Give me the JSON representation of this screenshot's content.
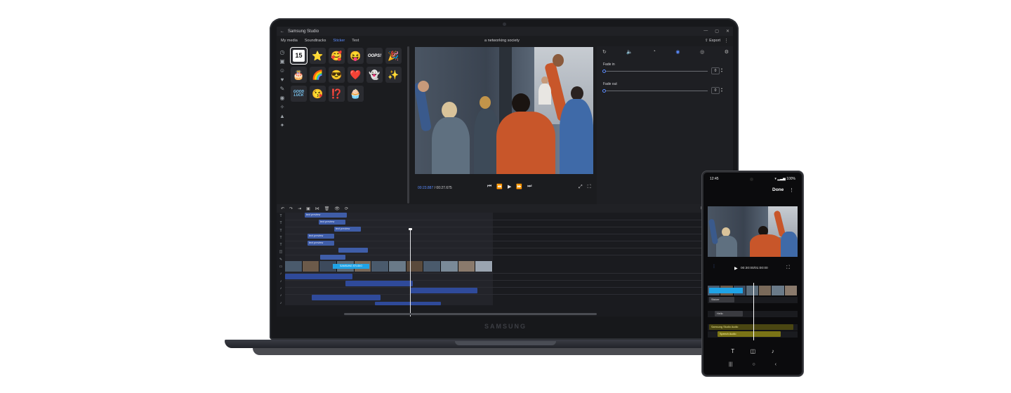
{
  "laptop": {
    "brand": "SAMSUNG",
    "app": {
      "title": "Samsung Studio",
      "back_icon": "arrow-left-icon",
      "tabs": [
        "My media",
        "Soundtracks",
        "Sticker",
        "Text"
      ],
      "active_tab": "Sticker",
      "project_name": "a networking society",
      "export_label": "Export",
      "stickers": [
        {
          "glyph": "15",
          "kind": "badge"
        },
        {
          "glyph": "⭐"
        },
        {
          "glyph": "🥰"
        },
        {
          "glyph": "😝"
        },
        {
          "glyph": "OOPS!",
          "kind": "text"
        },
        {
          "glyph": "🎉"
        },
        {
          "glyph": "🎂"
        },
        {
          "glyph": "🌈"
        },
        {
          "glyph": "😎"
        },
        {
          "glyph": "❤️"
        },
        {
          "glyph": "👻"
        },
        {
          "glyph": "✨"
        },
        {
          "glyph": "GOOD LUCK",
          "kind": "text"
        },
        {
          "glyph": "😘"
        },
        {
          "glyph": "⁉️"
        },
        {
          "glyph": "🧁"
        }
      ],
      "preview": {
        "current_time": "00:23.887",
        "total_time": "00:27.675"
      },
      "audio_panel": {
        "fade_in_label": "Fade in",
        "fade_in_value": "0",
        "fade_out_label": "Fade out",
        "fade_out_value": "0",
        "icons": [
          "rotate-icon",
          "volume-icon",
          "speed-icon",
          "fade-icon",
          "filter-icon",
          "settings-icon"
        ],
        "active_icon": "fade-icon"
      },
      "timeline": {
        "clips": [
          {
            "label": "text preview",
            "track": 0
          },
          {
            "label": "text preview",
            "track": 1
          },
          {
            "label": "text preview",
            "track": 2
          },
          {
            "label": "text preview",
            "track": 3
          },
          {
            "label": "text preview",
            "track": 4
          }
        ],
        "banner_text": "SAMSUNG STUDIO"
      }
    }
  },
  "phone": {
    "time": "12:45",
    "battery": "100%",
    "done_label": "Done",
    "playback": "00:30:00/01:00:00",
    "tracks": [
      {
        "label": "Sticker"
      },
      {
        "label": "Hello"
      },
      {
        "label": "Samsung Studio Audio"
      },
      {
        "label": "Speech Audio"
      }
    ],
    "colors": {
      "accent": "#5b8cff",
      "audio_track": "#7a7416"
    }
  }
}
